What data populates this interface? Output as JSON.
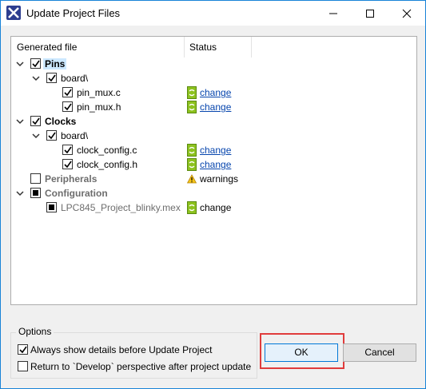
{
  "window": {
    "title": "Update Project Files"
  },
  "columns": {
    "file": "Generated file",
    "status": "Status"
  },
  "tree": {
    "pins": {
      "label": "Pins",
      "checked": true
    },
    "pins_board": {
      "label": "board\\",
      "checked": true
    },
    "pin_mux_c": {
      "label": "pin_mux.c",
      "checked": true,
      "status": "change"
    },
    "pin_mux_h": {
      "label": "pin_mux.h",
      "checked": true,
      "status": "change"
    },
    "clocks": {
      "label": "Clocks",
      "checked": true
    },
    "clocks_board": {
      "label": "board\\",
      "checked": true
    },
    "clock_config_c": {
      "label": "clock_config.c",
      "checked": true,
      "status": "change"
    },
    "clock_config_h": {
      "label": "clock_config.h",
      "checked": true,
      "status": "change"
    },
    "peripherals": {
      "label": "Peripherals",
      "checked": false,
      "status": "warnings"
    },
    "configuration": {
      "label": "Configuration",
      "state": "partial"
    },
    "mex_file": {
      "label": "LPC845_Project_blinky.mex",
      "state": "partial",
      "status": "change"
    }
  },
  "options": {
    "legend": "Options",
    "always_show": {
      "label": "Always show details before Update Project",
      "checked": true
    },
    "return_develop": {
      "label": "Return to `Develop` perspective after project update",
      "checked": false
    }
  },
  "buttons": {
    "ok": "OK",
    "cancel": "Cancel"
  },
  "colors": {
    "accent": "#0078d7",
    "highlight": "#e03c3c",
    "change_icon": "#8dc21f",
    "link": "#0645ad"
  }
}
